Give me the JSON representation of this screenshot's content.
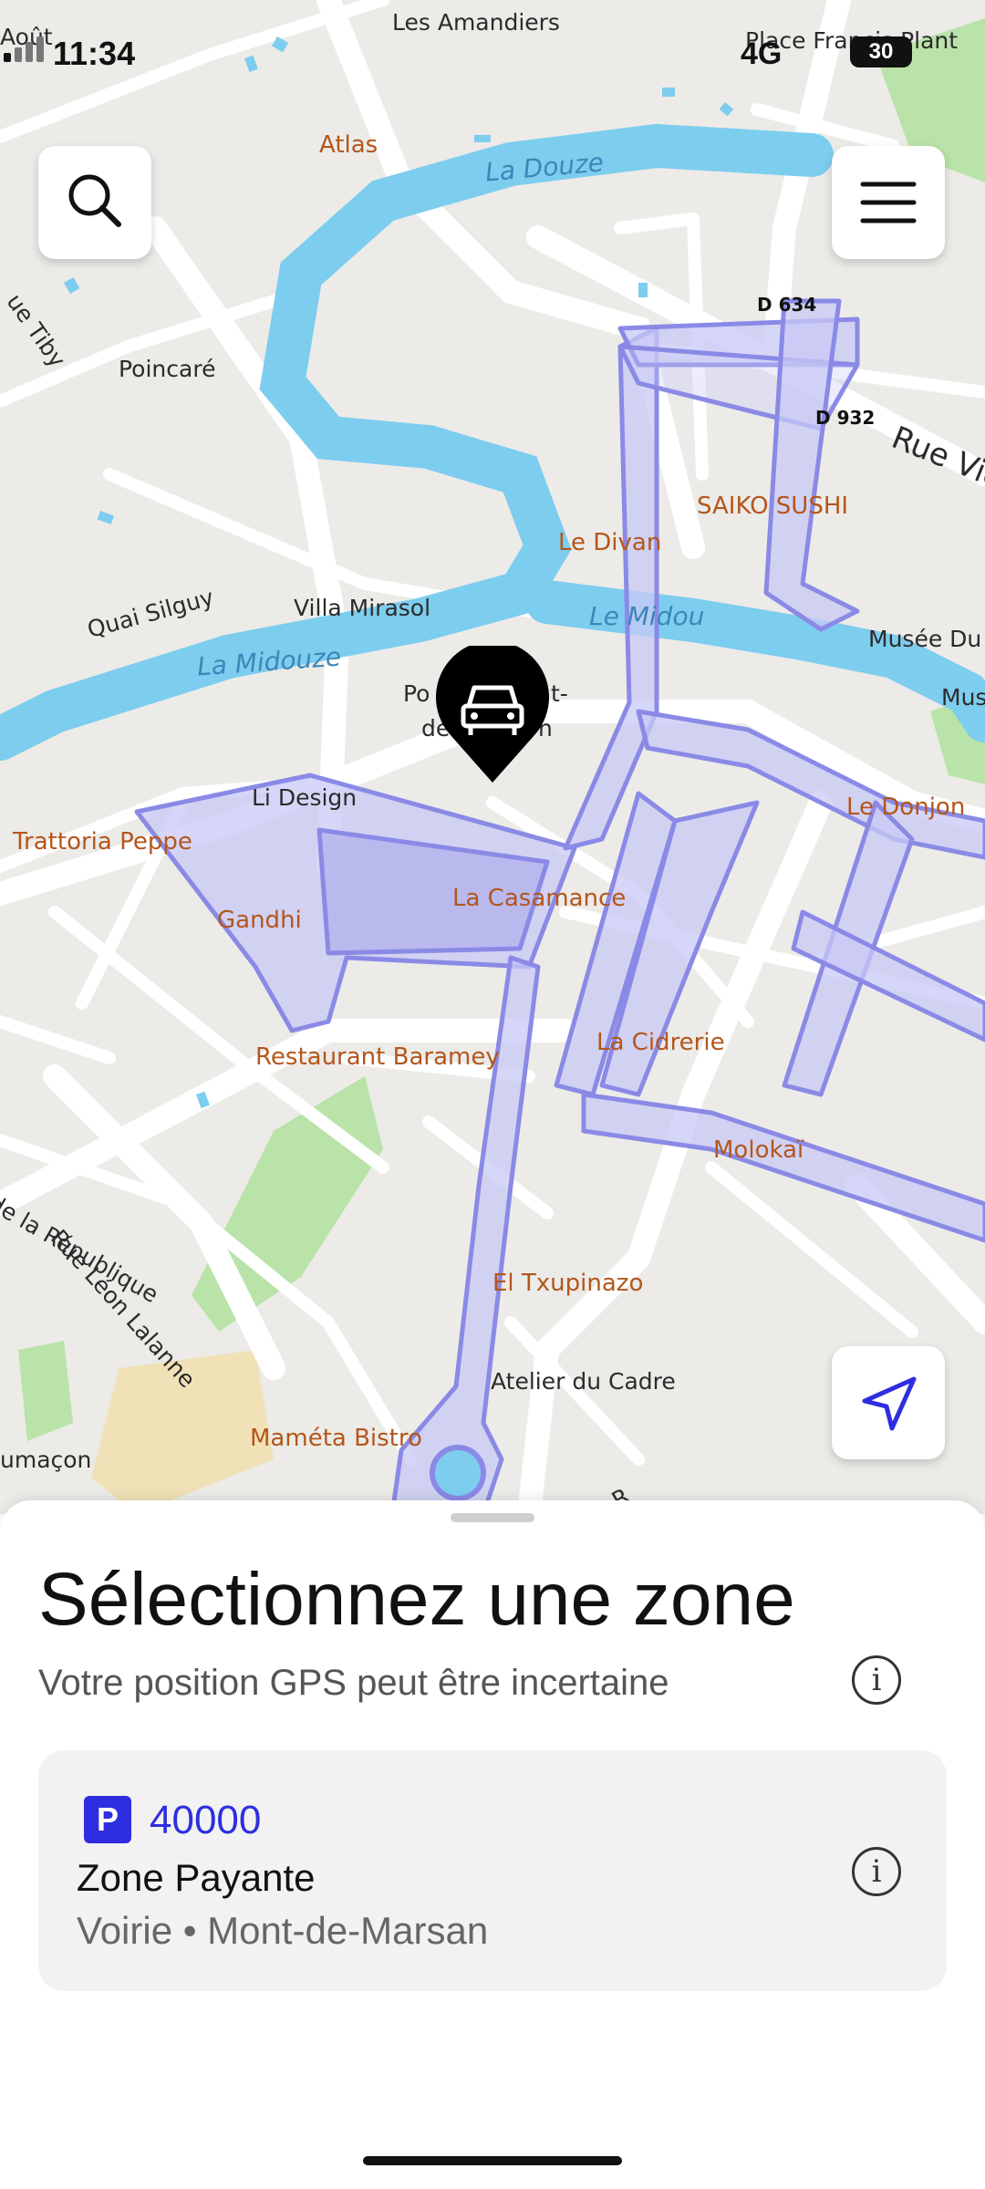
{
  "status_bar": {
    "time": "11:34",
    "network": "4G",
    "battery": "30"
  },
  "map": {
    "places": {
      "les_amandiers": "Les Amandiers",
      "place_francis_plant": "Place Francis Plant",
      "aout": "Août",
      "atlas": "Atlas",
      "la_douze": "La Douze",
      "d634": "D 634",
      "d932": "D 932",
      "rue_tiby": "ue Tiby",
      "poincare": "Poincaré",
      "rue_vic": "Rue Vic",
      "saiko_sushi": "SAIKO SUSHI",
      "le_divan": "Le Divan",
      "quai_silguy": "Quai Silguy",
      "villa_mirasol": "Villa Mirasol",
      "le_midou": "Le Midou",
      "musee_du": "Musée Du",
      "mus": "Mus",
      "la_midouze": "La Midouze",
      "pont_a": "Po",
      "pont_b": "t-",
      "pont_c": "de",
      "pont_d": "n",
      "li_design": "Li Design",
      "le_donjon": "Le Donjon",
      "trattoria_peppe": "Trattoria Peppe",
      "gandhi": "Gandhi",
      "la_casamance": "La Casamance",
      "restaurant_baramey": "Restaurant Baramey",
      "la_cidrerie": "La Cidrerie",
      "molokai": "Molokaï",
      "rue_leon_lalanne": "Rue Léon Lalanne",
      "de_la_republique": "de la République",
      "el_txupinazo": "El Txupinazo",
      "atelier_du_cadre": "Atelier du Cadre",
      "mameta_bistro": "Maméta Bistro",
      "umacon": "umaçon",
      "r": "R"
    }
  },
  "buttons": {
    "search_icon": "search-icon",
    "menu_icon": "menu-icon",
    "locate_icon": "navigation-arrow-icon"
  },
  "sheet": {
    "title": "Sélectionnez une zone",
    "subtitle": "Votre position GPS peut être incertaine",
    "info_glyph": "i",
    "zone": {
      "badge": "P",
      "code": "40000",
      "name": "Zone Payante",
      "meta": "Voirie • Mont-de-Marsan"
    }
  },
  "colors": {
    "accent": "#2e2ee0",
    "zone_fill": "#c8c8f5",
    "river": "#7dcdef",
    "park": "#b9e3a8"
  }
}
